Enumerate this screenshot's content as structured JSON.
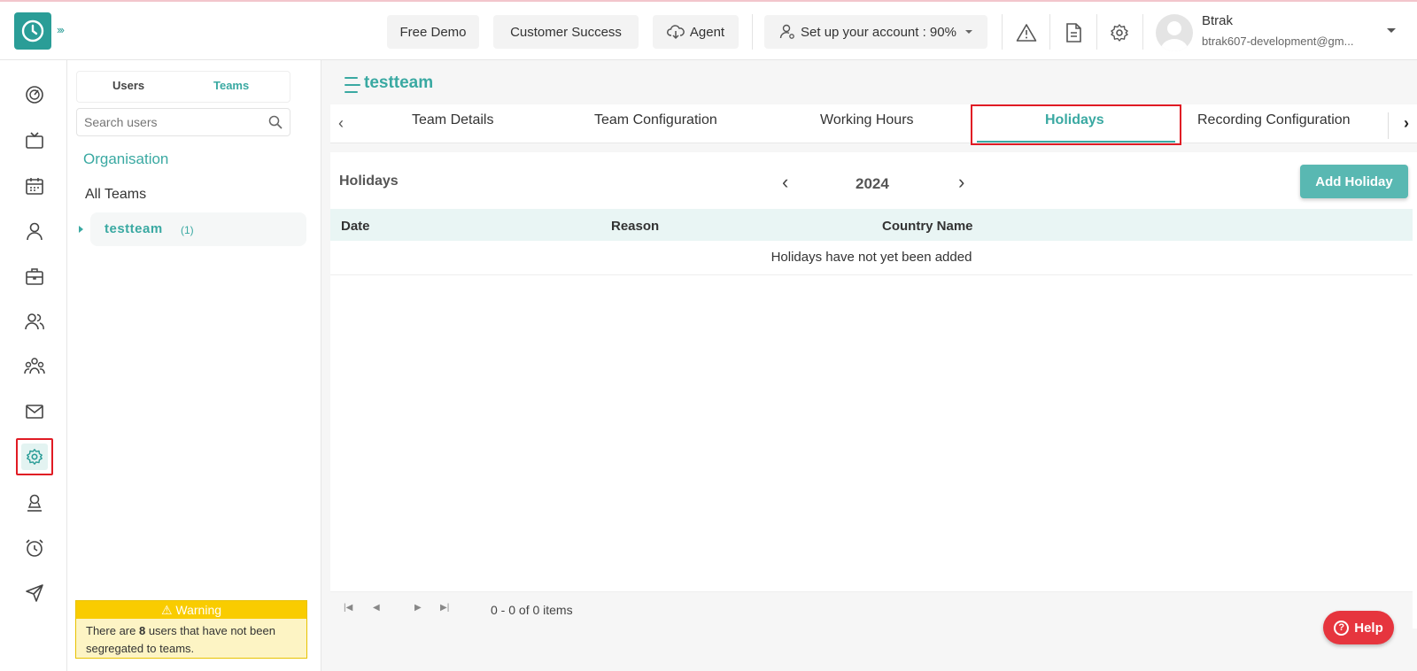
{
  "topbar": {
    "free_demo": "Free Demo",
    "customer_success": "Customer Success",
    "agent": "Agent",
    "setup": "Set up your account : 90%",
    "user_name": "Btrak",
    "user_email": "btrak607-development@gm..."
  },
  "left_panel": {
    "tab_users": "Users",
    "tab_teams": "Teams",
    "search_placeholder": "Search users",
    "organisation": "Organisation",
    "all_teams": "All Teams",
    "team_name": "testteam",
    "team_count": "(1)",
    "warning_title": "Warning",
    "warning_prefix": "There are ",
    "warning_count": "8",
    "warning_suffix": " users that have not been segregated to teams."
  },
  "main": {
    "page_title": "testteam",
    "tabs": [
      {
        "label": "Team Details"
      },
      {
        "label": "Team Configuration"
      },
      {
        "label": "Working Hours"
      },
      {
        "label": "Holidays"
      },
      {
        "label": "Recording Configuration"
      }
    ],
    "section_title": "Holidays",
    "year": "2024",
    "add_button": "Add Holiday",
    "columns": [
      "Date",
      "Reason",
      "Country Name"
    ],
    "empty_message": "Holidays have not yet been added",
    "pager_info": "0 - 0 of 0 items",
    "help": "Help"
  },
  "colors": {
    "accent": "#3aa9a2",
    "highlight_border": "#e01b24",
    "warning": "#f9cc00",
    "help": "#e6353e"
  }
}
